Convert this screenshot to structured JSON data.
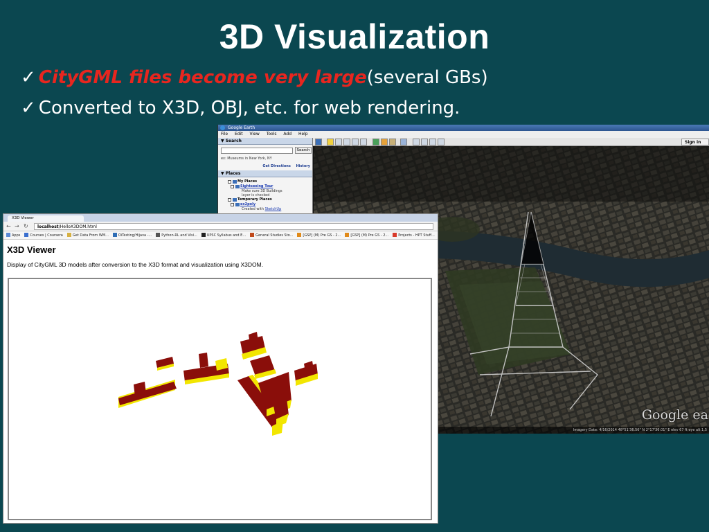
{
  "slide": {
    "title": "3D Visualization",
    "bullets": [
      {
        "check": "✓",
        "emph": "CityGML files become very large",
        "rest": "(several GBs)"
      },
      {
        "check": "✓",
        "emph": "",
        "rest": "Converted to X3D, OBJ, etc. for web rendering."
      }
    ]
  },
  "google_earth": {
    "window_title": "Google Earth",
    "menu": [
      "File",
      "Edit",
      "View",
      "Tools",
      "Add",
      "Help"
    ],
    "sign_in": "Sign in",
    "search_panel": {
      "title": "▼ Search",
      "button": "Search",
      "hint": "ex: Museums in New York, NY",
      "get_directions": "Get Directions",
      "history": "History"
    },
    "places_panel": {
      "title": "▼ Places",
      "my_places": "My Places",
      "sightseeing_tour": "Sightseeing Tour",
      "tour_note_1": "Make sure 3D Buildings",
      "tour_note_2": "layer is checked",
      "temporary_places": "Temporary Places",
      "ex2": "ex2poly",
      "created_with_prefix": "Created with ",
      "created_with_link": "SketchUp"
    },
    "watermark": "Google ea",
    "status": "Imagery Date: 4/16/2014    48°51'36.56\" N    2°17'36.01\" E  elev   67 ft     eye alt 1,5"
  },
  "x3d_browser": {
    "tab_title": "X3D Viewer",
    "url_host": "localhost",
    "url_path": "/HelloX3DOM.html",
    "bookmarks": [
      {
        "label": "Apps",
        "color": "#5c8ad6"
      },
      {
        "label": "Courses | Coursera",
        "color": "#3a6fcf"
      },
      {
        "label": "Get Data From WM...",
        "color": "#d6b144"
      },
      {
        "label": "OiTesting/Hijava -...",
        "color": "#2e6db5"
      },
      {
        "label": "Python-RL and Visi...",
        "color": "#555555"
      },
      {
        "label": "UPSC Syllabus and E...",
        "color": "#222222"
      },
      {
        "label": "General Studies Sto...",
        "color": "#c04a1c"
      },
      {
        "label": "[GSP] (M) Pre GS - 2...",
        "color": "#e08a1a"
      },
      {
        "label": "[GSP] (M) Pre GS - 2...",
        "color": "#e08a1a"
      },
      {
        "label": "Projects - HPT Stuff...",
        "color": "#d83a2a"
      }
    ],
    "heading": "X3D Viewer",
    "description": "Display of CityGML 3D models after conversion to the X3D format and visualization using X3DOM."
  },
  "colors": {
    "background": "#0b4750",
    "emphasis": "#e8261f",
    "building_side": "#8a0e0a",
    "building_top": "#f2e600"
  }
}
